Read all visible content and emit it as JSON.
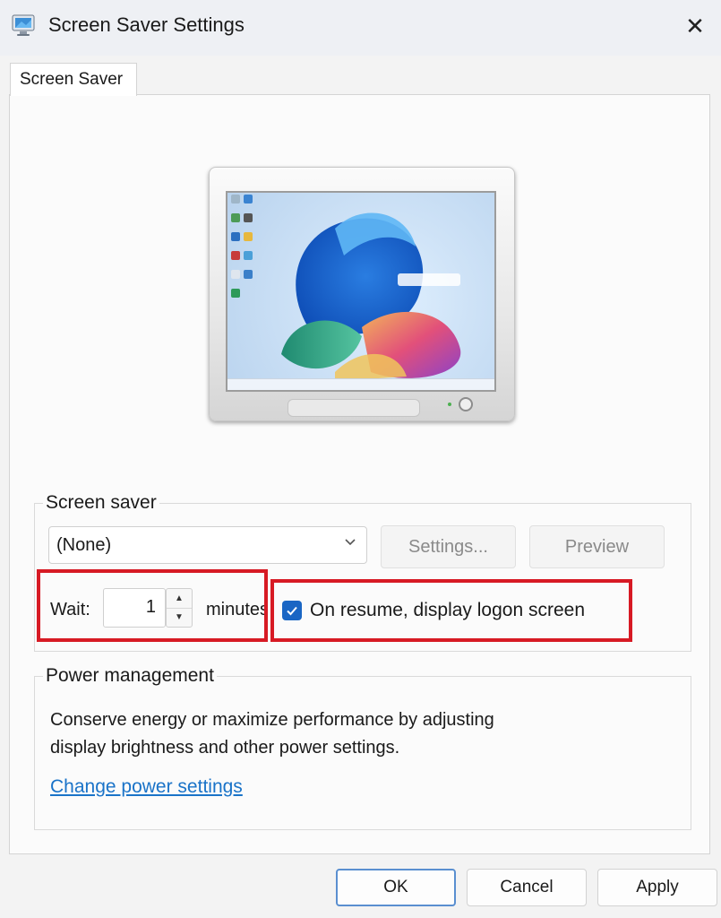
{
  "window": {
    "title": "Screen Saver Settings"
  },
  "tabs": [
    {
      "label": "Screen Saver"
    }
  ],
  "screen_saver": {
    "group_label": "Screen saver",
    "selected": "(None)",
    "settings_label": "Settings...",
    "preview_label": "Preview",
    "wait_label": "Wait:",
    "wait_value": "1",
    "minutes_label": "minutes",
    "on_resume_checked": true,
    "on_resume_label": "On resume, display logon screen"
  },
  "power": {
    "group_label": "Power management",
    "description_line1": "Conserve energy or maximize performance by adjusting",
    "description_line2": "display brightness and other power settings.",
    "link": "Change power settings"
  },
  "buttons": {
    "ok": "OK",
    "cancel": "Cancel",
    "apply": "Apply"
  },
  "colors": {
    "accent": "#1a66c4",
    "link": "#1a73c8",
    "highlight": "#d71a24"
  },
  "icons": {
    "app": "screen-saver-monitor-icon",
    "close": "close-icon",
    "dropdown": "chevron-down-icon",
    "spin_up": "arrow-up-icon",
    "spin_down": "arrow-down-icon",
    "check": "checkmark-icon"
  }
}
